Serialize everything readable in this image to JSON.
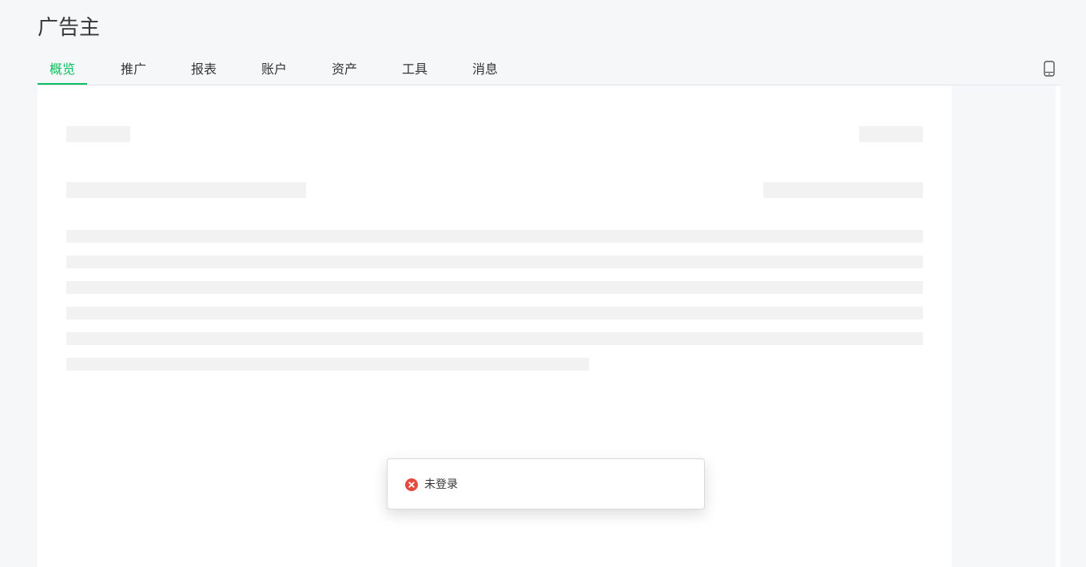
{
  "header": {
    "title": "广告主"
  },
  "nav": {
    "tabs": [
      {
        "label": "概览",
        "active": true
      },
      {
        "label": "推广",
        "active": false
      },
      {
        "label": "报表",
        "active": false
      },
      {
        "label": "账户",
        "active": false
      },
      {
        "label": "资产",
        "active": false
      },
      {
        "label": "工具",
        "active": false
      },
      {
        "label": "消息",
        "active": false
      }
    ],
    "right_icon": "mobile-phone-icon"
  },
  "toast": {
    "icon": "error-circle-icon",
    "message": "未登录"
  },
  "colors": {
    "accent": "#07c160",
    "error": "#e54a3f",
    "skeleton": "#f2f2f2",
    "page_bg": "#f6f7f8"
  }
}
